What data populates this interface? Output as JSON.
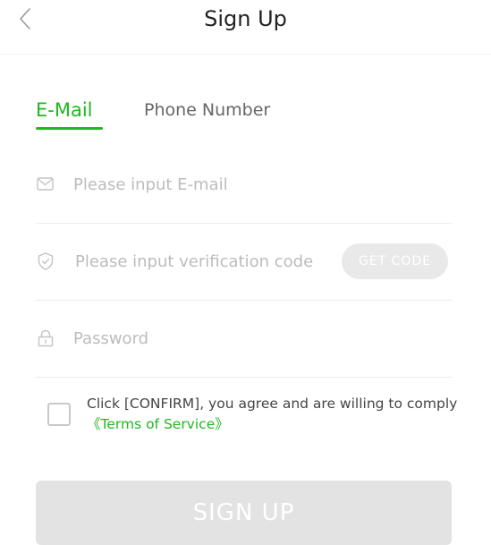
{
  "header": {
    "title": "Sign Up",
    "back_icon": "chevron-left-icon"
  },
  "tabs": [
    {
      "label": "E-Mail",
      "active": true
    },
    {
      "label": "Phone Number",
      "active": false
    }
  ],
  "form": {
    "email": {
      "placeholder": "Please input E-mail",
      "value": "",
      "icon": "mail-icon"
    },
    "code": {
      "placeholder": "Please input verification code",
      "value": "",
      "icon": "shield-check-icon",
      "button_label": "GET CODE"
    },
    "password": {
      "placeholder": "Password",
      "value": "",
      "icon": "lock-icon"
    }
  },
  "terms": {
    "checked": false,
    "text": "Click [CONFIRM], you agree and are willing to comply ",
    "link_label": "《Terms of Service》"
  },
  "submit": {
    "label": "SIGN UP"
  },
  "colors": {
    "accent": "#1fb81f",
    "placeholder": "#bcbcbc",
    "disabled_button": "#e3e3e3",
    "divider": "#ececec"
  }
}
